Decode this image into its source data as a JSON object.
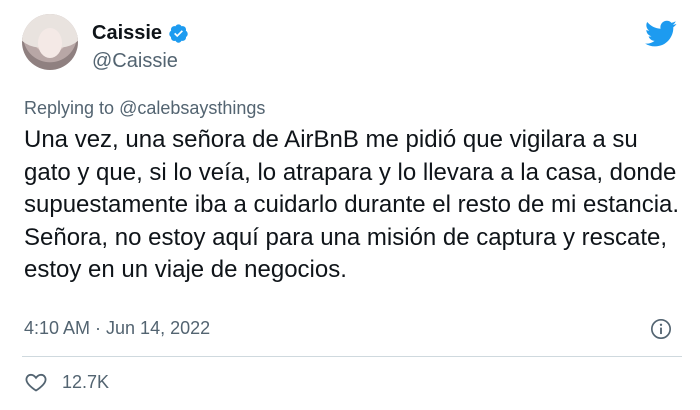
{
  "author": {
    "display_name": "Caissie",
    "handle": "@Caissie"
  },
  "reply": {
    "prefix": "Replying to",
    "mention": "@calebsaysthings"
  },
  "tweet": {
    "text": "Una vez, una señora de AirBnB me pidió que vigilara a su gato y que, si lo veía, lo atrapara y lo llevara a la casa, donde supuestamente iba a cuidarlo durante el resto de mi estancia. Señora, no estoy aquí para una misión de captura y rescate, estoy en un viaje de negocios.",
    "timestamp": "4:10 AM · Jun 14, 2022"
  },
  "stats": {
    "likes": "12.7K"
  },
  "icons": {
    "verified": "verified-badge-icon",
    "brand": "twitter-bird-icon",
    "info": "info-icon",
    "like": "heart-icon"
  },
  "colors": {
    "brand_blue": "#1d9bf0",
    "text": "#0f1419",
    "secondary": "#536471",
    "divider": "#cfd9de"
  }
}
